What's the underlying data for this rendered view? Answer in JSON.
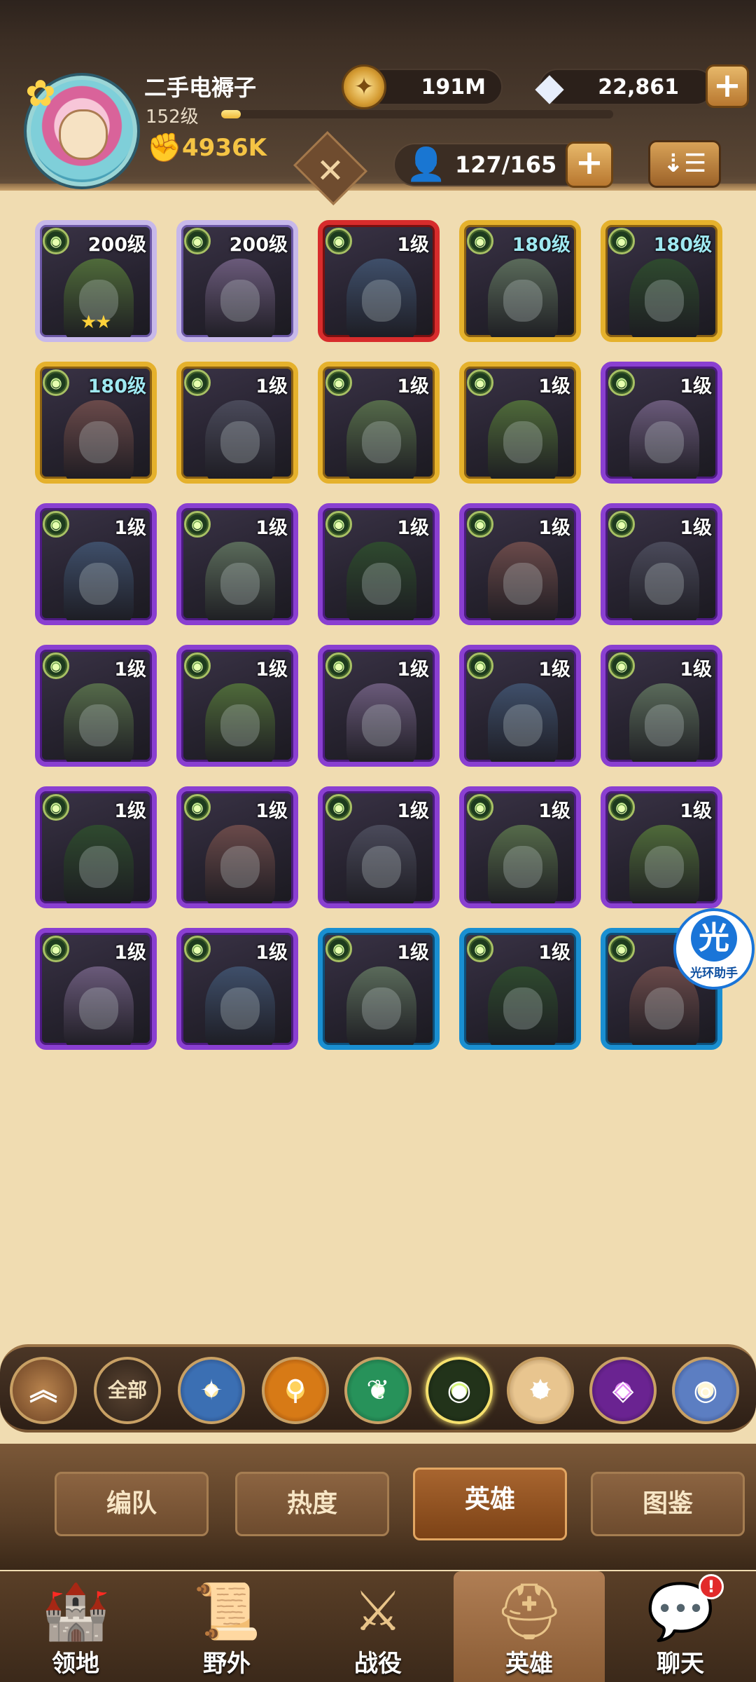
{
  "player": {
    "name": "二手电褥子",
    "level": "152级",
    "xp_fraction": 0.05,
    "power": "4936K"
  },
  "currency": {
    "gold": "191M",
    "diamonds": "22,861"
  },
  "heroes_count": "127/165",
  "heroes": [
    {
      "level": "200级",
      "frame": "white",
      "stars": 2,
      "level_color": "white"
    },
    {
      "level": "200级",
      "frame": "white",
      "stars": 0,
      "level_color": "white"
    },
    {
      "level": "1级",
      "frame": "red",
      "stars": 0,
      "level_color": "white"
    },
    {
      "level": "180级",
      "frame": "gold",
      "stars": 0,
      "level_color": "teal"
    },
    {
      "level": "180级",
      "frame": "gold",
      "stars": 0,
      "level_color": "teal"
    },
    {
      "level": "180级",
      "frame": "gold",
      "stars": 0,
      "level_color": "teal"
    },
    {
      "level": "1级",
      "frame": "gold",
      "stars": 0,
      "level_color": "white"
    },
    {
      "level": "1级",
      "frame": "gold",
      "stars": 0,
      "level_color": "white"
    },
    {
      "level": "1级",
      "frame": "gold",
      "stars": 0,
      "level_color": "white"
    },
    {
      "level": "1级",
      "frame": "purple",
      "stars": 0,
      "level_color": "white"
    },
    {
      "level": "1级",
      "frame": "purple",
      "stars": 0,
      "level_color": "white"
    },
    {
      "level": "1级",
      "frame": "purple",
      "stars": 0,
      "level_color": "white"
    },
    {
      "level": "1级",
      "frame": "purple",
      "stars": 0,
      "level_color": "white"
    },
    {
      "level": "1级",
      "frame": "purple",
      "stars": 0,
      "level_color": "white"
    },
    {
      "level": "1级",
      "frame": "purple",
      "stars": 0,
      "level_color": "white"
    },
    {
      "level": "1级",
      "frame": "purple",
      "stars": 0,
      "level_color": "white"
    },
    {
      "level": "1级",
      "frame": "purple",
      "stars": 0,
      "level_color": "white"
    },
    {
      "level": "1级",
      "frame": "purple",
      "stars": 0,
      "level_color": "white"
    },
    {
      "level": "1级",
      "frame": "purple",
      "stars": 0,
      "level_color": "white"
    },
    {
      "level": "1级",
      "frame": "purple",
      "stars": 0,
      "level_color": "white"
    },
    {
      "level": "1级",
      "frame": "purple",
      "stars": 0,
      "level_color": "white"
    },
    {
      "level": "1级",
      "frame": "purple",
      "stars": 0,
      "level_color": "white"
    },
    {
      "level": "1级",
      "frame": "purple",
      "stars": 0,
      "level_color": "white"
    },
    {
      "level": "1级",
      "frame": "purple",
      "stars": 0,
      "level_color": "white"
    },
    {
      "level": "1级",
      "frame": "purple",
      "stars": 0,
      "level_color": "white"
    },
    {
      "level": "1级",
      "frame": "purple",
      "stars": 0,
      "level_color": "white"
    },
    {
      "level": "1级",
      "frame": "purple",
      "stars": 0,
      "level_color": "white"
    },
    {
      "level": "1级",
      "frame": "blue",
      "stars": 0,
      "level_color": "white"
    },
    {
      "level": "1级",
      "frame": "blue",
      "stars": 0,
      "level_color": "white"
    },
    {
      "level": "1级",
      "frame": "blue",
      "stars": 0,
      "level_color": "white"
    }
  ],
  "assistant": {
    "label": "光环助手",
    "glyph": "光"
  },
  "faction_filter": {
    "all_label": "全部",
    "icons": [
      "collapse-up-icon",
      "all-factions-icon",
      "lightbearer-icon",
      "mauler-icon",
      "wilder-icon",
      "graveborn-icon",
      "celestial-icon",
      "hypogean-icon",
      "dimensional-icon"
    ],
    "active_index": 5
  },
  "tabs": [
    {
      "label": "编队"
    },
    {
      "label": "热度"
    },
    {
      "label": "英雄"
    },
    {
      "label": "图鉴"
    }
  ],
  "active_tab": "英雄",
  "nav": [
    {
      "label": "领地",
      "icon": "castle-icon"
    },
    {
      "label": "野外",
      "icon": "scroll-map-icon"
    },
    {
      "label": "战役",
      "icon": "battle-shield-icon"
    },
    {
      "label": "英雄",
      "icon": "helmet-icon"
    },
    {
      "label": "聊天",
      "icon": "chat-bubble-icon",
      "badge": "!"
    }
  ],
  "active_nav": "英雄"
}
